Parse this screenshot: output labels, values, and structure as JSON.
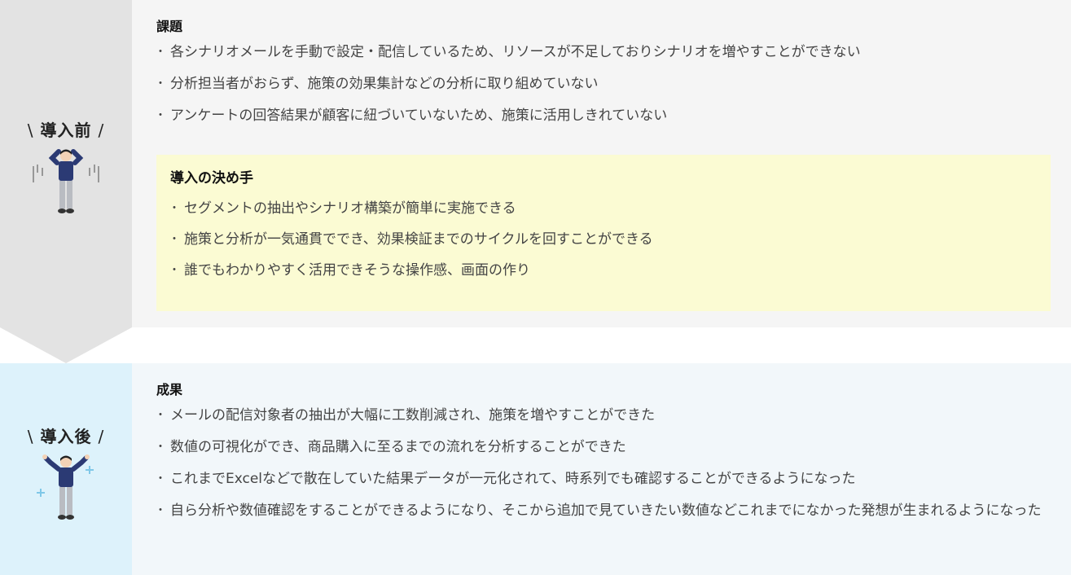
{
  "before": {
    "label": "導入前",
    "slash_left": "\\",
    "slash_right": "/",
    "heading": "課題",
    "items": [
      "各シナリオメールを手動で設定・配信しているため、リソースが不足しておりシナリオを増やすことができない",
      "分析担当者がおらず、施策の効果集計などの分析に取り組めていない",
      "アンケートの回答結果が顧客に紐づいていないため、施策に活用しきれていない"
    ],
    "figure_icon": "worried-person-icon"
  },
  "decision": {
    "heading": "導入の決め手",
    "items": [
      "セグメントの抽出やシナリオ構築が簡単に実施できる",
      "施策と分析が一気通貫ででき、効果検証までのサイクルを回すことができる",
      "誰でもわかりやすく活用できそうな操作感、画面の作り"
    ]
  },
  "after": {
    "label": "導入後",
    "slash_left": "\\",
    "slash_right": "/",
    "heading": "成果",
    "items": [
      "メールの配信対象者の抽出が大幅に工数削減され、施策を増やすことができた",
      "数値の可視化ができ、商品購入に至るまでの流れを分析することができた",
      "これまでExcelなどで散在していた結果データが一元化されて、時系列でも確認することができるようになった",
      "自ら分析や数値確認をすることができるようになり、そこから追加で見ていきたい数値などこれまでになかった発想が生まれるようになった"
    ],
    "figure_icon": "happy-person-icon"
  },
  "colors": {
    "before_bg": "#f5f5f5",
    "before_side": "#e3e3e3",
    "after_bg": "#f2f7fa",
    "after_side": "#ddf2fb",
    "keybox_bg": "#fbfbd3",
    "figure_shirt": "#2b3a74",
    "figure_pants": "#b9bcc2",
    "sparkle": "#7fc8e8"
  }
}
